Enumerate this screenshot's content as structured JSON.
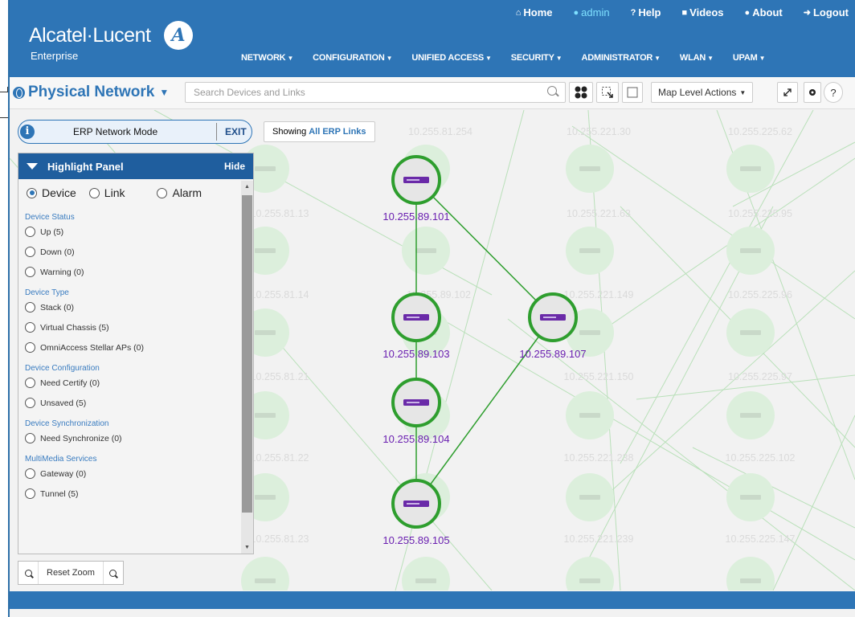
{
  "header": {
    "brand": "Alcatel·Lucent",
    "brand_sub": "Enterprise",
    "brand_mark": "A",
    "top_links": [
      {
        "label": "Home",
        "icon": "home-icon"
      },
      {
        "label": "admin",
        "icon": "user-icon"
      },
      {
        "label": "Help",
        "icon": "help-icon"
      },
      {
        "label": "Videos",
        "icon": "video-icon"
      },
      {
        "label": "About",
        "icon": "info-icon"
      },
      {
        "label": "Logout",
        "icon": "logout-icon"
      }
    ],
    "nav": [
      "NETWORK",
      "CONFIGURATION",
      "UNIFIED ACCESS",
      "SECURITY",
      "ADMINISTRATOR",
      "WLAN",
      "UPAM"
    ]
  },
  "toolbar": {
    "title": "Physical Network",
    "search_placeholder": "Search Devices and Links",
    "map_level_actions": "Map Level Actions"
  },
  "erp": {
    "mode_label": "ERP Network Mode",
    "exit_label": "EXIT",
    "showing_prefix": "Showing",
    "showing_value": "All ERP Links"
  },
  "highlight_panel": {
    "title": "Highlight Panel",
    "hide_label": "Hide",
    "tabs": [
      {
        "label": "Device",
        "selected": true
      },
      {
        "label": "Link",
        "selected": false
      },
      {
        "label": "Alarm",
        "selected": false
      }
    ],
    "sections": [
      {
        "title": "Device Status",
        "options": [
          "Up (5)",
          "Down (0)",
          "Warning (0)"
        ]
      },
      {
        "title": "Device Type",
        "options": [
          "Stack (0)",
          "Virtual Chassis (5)",
          "OmniAccess Stellar APs (0)"
        ]
      },
      {
        "title": "Device Configuration",
        "options": [
          "Need Certify (0)",
          "Unsaved (5)"
        ]
      },
      {
        "title": "Device Synchronization",
        "options": [
          "Need Synchronize (0)"
        ]
      },
      {
        "title": "MultiMedia Services",
        "options": [
          "Gateway (0)",
          "Tunnel (5)"
        ]
      }
    ]
  },
  "zoom": {
    "reset_label": "Reset Zoom"
  },
  "devices": [
    {
      "ip": "10.255.89.101"
    },
    {
      "ip": "10.255.89.103"
    },
    {
      "ip": "10.255.89.104"
    },
    {
      "ip": "10.255.89.105"
    },
    {
      "ip": "10.255.89.107"
    }
  ],
  "ghost_labels": [
    "10.255.81.254",
    "10.255.221.30",
    "10.255.225.62",
    "10.255.81.13",
    "10.255.221.63",
    "10.255.225.95",
    "10.255.81.14",
    "10.255.89.102",
    "10.255.221.149",
    "10.255.225.96",
    "10.255.81.21",
    "10.255.221.150",
    "10.255.225.97",
    "10.255.81.22",
    "10.255.221.238",
    "10.255.225.102",
    "10.255.81.23",
    "10.255.221.239",
    "10.255.225.147"
  ],
  "colors": {
    "header_blue": "#2e75b6",
    "device_ring": "#2e9e2e",
    "ip_label": "#6a1fb0"
  }
}
